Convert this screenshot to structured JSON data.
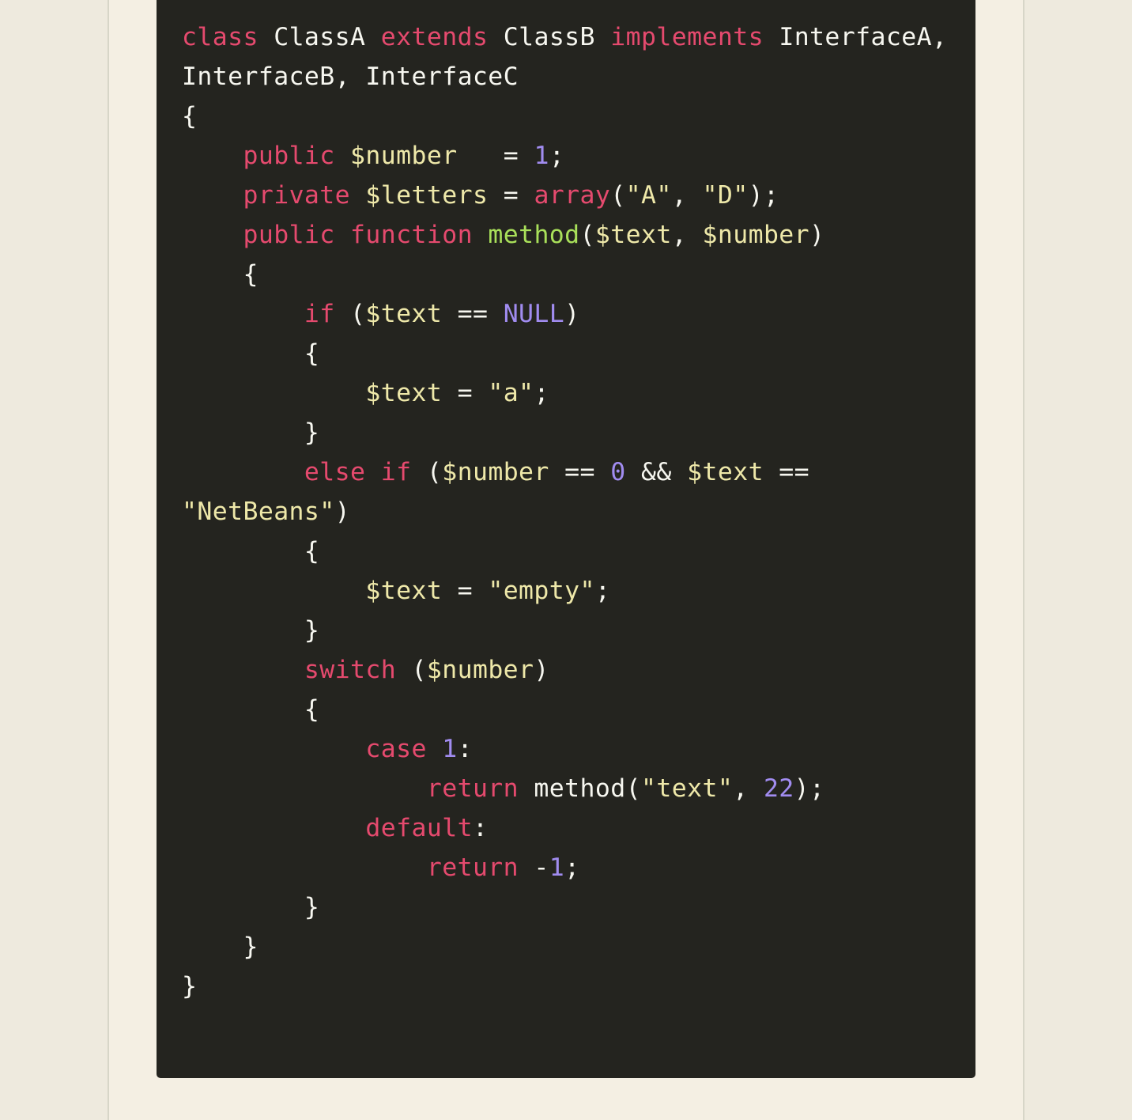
{
  "page": {
    "background_color": "#f4efe3",
    "margin_band_color": "#eeeade",
    "rule_color": "#d7d6c8"
  },
  "code_block": {
    "background_color": "#24241f",
    "language": "php",
    "theme": "dark",
    "font_size_px": 31.5,
    "line_height_px": 50,
    "wrapped": true,
    "palette": {
      "keyword": "#e54a6e",
      "variable": "#eee8a9",
      "string": "#eee8a9",
      "function_name": "#a9e05a",
      "number": "#a18cf0",
      "punctuation": "#f7f7f0",
      "plain": "#f7f7f0"
    },
    "lines": [
      {
        "id": "l1",
        "indent": 0,
        "tokens": [
          {
            "t": "class",
            "c": "kw"
          },
          {
            "t": " ",
            "c": "pl"
          },
          {
            "t": "ClassA",
            "c": "pl"
          },
          {
            "t": " ",
            "c": "pl"
          },
          {
            "t": "extends",
            "c": "kw"
          },
          {
            "t": " ",
            "c": "pl"
          },
          {
            "t": "ClassB",
            "c": "pl"
          },
          {
            "t": " ",
            "c": "pl"
          },
          {
            "t": "implements",
            "c": "kw"
          },
          {
            "t": " ",
            "c": "pl"
          },
          {
            "t": "InterfaceA, InterfaceB, InterfaceC",
            "c": "pl"
          }
        ]
      },
      {
        "id": "l2",
        "indent": 0,
        "tokens": [
          {
            "t": "{",
            "c": "pun"
          }
        ]
      },
      {
        "id": "l3",
        "indent": 4,
        "tokens": [
          {
            "t": "public",
            "c": "kw"
          },
          {
            "t": " ",
            "c": "pl"
          },
          {
            "t": "$number",
            "c": "var"
          },
          {
            "t": "   = ",
            "c": "pun"
          },
          {
            "t": "1",
            "c": "num"
          },
          {
            "t": ";",
            "c": "pun"
          }
        ]
      },
      {
        "id": "l4",
        "indent": 4,
        "tokens": [
          {
            "t": "private",
            "c": "kw"
          },
          {
            "t": " ",
            "c": "pl"
          },
          {
            "t": "$letters",
            "c": "var"
          },
          {
            "t": " = ",
            "c": "pun"
          },
          {
            "t": "array",
            "c": "kw"
          },
          {
            "t": "(",
            "c": "pun"
          },
          {
            "t": "\"A\"",
            "c": "str"
          },
          {
            "t": ", ",
            "c": "pun"
          },
          {
            "t": "\"D\"",
            "c": "str"
          },
          {
            "t": ");",
            "c": "pun"
          }
        ]
      },
      {
        "id": "l5",
        "indent": 4,
        "tokens": [
          {
            "t": "public",
            "c": "kw"
          },
          {
            "t": " ",
            "c": "pl"
          },
          {
            "t": "function",
            "c": "kw"
          },
          {
            "t": " ",
            "c": "pl"
          },
          {
            "t": "method",
            "c": "fn"
          },
          {
            "t": "(",
            "c": "pun"
          },
          {
            "t": "$text",
            "c": "var"
          },
          {
            "t": ", ",
            "c": "pun"
          },
          {
            "t": "$number",
            "c": "var"
          },
          {
            "t": ")",
            "c": "pun"
          }
        ]
      },
      {
        "id": "l6",
        "indent": 4,
        "tokens": [
          {
            "t": "{",
            "c": "pun"
          }
        ]
      },
      {
        "id": "l7",
        "indent": 8,
        "tokens": [
          {
            "t": "if",
            "c": "kw"
          },
          {
            "t": " (",
            "c": "pun"
          },
          {
            "t": "$text",
            "c": "var"
          },
          {
            "t": " == ",
            "c": "pun"
          },
          {
            "t": "NULL",
            "c": "num"
          },
          {
            "t": ")",
            "c": "pun"
          }
        ]
      },
      {
        "id": "l8",
        "indent": 8,
        "tokens": [
          {
            "t": "{",
            "c": "pun"
          }
        ]
      },
      {
        "id": "l9",
        "indent": 12,
        "tokens": [
          {
            "t": "$text",
            "c": "var"
          },
          {
            "t": " = ",
            "c": "pun"
          },
          {
            "t": "\"a\"",
            "c": "str"
          },
          {
            "t": ";",
            "c": "pun"
          }
        ]
      },
      {
        "id": "l10",
        "indent": 8,
        "tokens": [
          {
            "t": "}",
            "c": "pun"
          }
        ]
      },
      {
        "id": "l11",
        "indent": 8,
        "tokens": [
          {
            "t": "else",
            "c": "kw"
          },
          {
            "t": " ",
            "c": "pl"
          },
          {
            "t": "if",
            "c": "kw"
          },
          {
            "t": " (",
            "c": "pun"
          },
          {
            "t": "$number",
            "c": "var"
          },
          {
            "t": " == ",
            "c": "pun"
          },
          {
            "t": "0",
            "c": "num"
          },
          {
            "t": " && ",
            "c": "pun"
          },
          {
            "t": "$text",
            "c": "var"
          },
          {
            "t": " == ",
            "c": "pun"
          },
          {
            "t": "\"NetBeans\"",
            "c": "str"
          },
          {
            "t": ")",
            "c": "pun"
          }
        ]
      },
      {
        "id": "l12",
        "indent": 8,
        "tokens": [
          {
            "t": "{",
            "c": "pun"
          }
        ]
      },
      {
        "id": "l13",
        "indent": 12,
        "tokens": [
          {
            "t": "$text",
            "c": "var"
          },
          {
            "t": " = ",
            "c": "pun"
          },
          {
            "t": "\"empty\"",
            "c": "str"
          },
          {
            "t": ";",
            "c": "pun"
          }
        ]
      },
      {
        "id": "l14",
        "indent": 8,
        "tokens": [
          {
            "t": "}",
            "c": "pun"
          }
        ]
      },
      {
        "id": "l15",
        "indent": 8,
        "tokens": [
          {
            "t": "switch",
            "c": "kw"
          },
          {
            "t": " (",
            "c": "pun"
          },
          {
            "t": "$number",
            "c": "var"
          },
          {
            "t": ")",
            "c": "pun"
          }
        ]
      },
      {
        "id": "l16",
        "indent": 8,
        "tokens": [
          {
            "t": "{",
            "c": "pun"
          }
        ]
      },
      {
        "id": "l17",
        "indent": 12,
        "tokens": [
          {
            "t": "case",
            "c": "kw"
          },
          {
            "t": " ",
            "c": "pl"
          },
          {
            "t": "1",
            "c": "num"
          },
          {
            "t": ":",
            "c": "pun"
          }
        ]
      },
      {
        "id": "l18",
        "indent": 16,
        "tokens": [
          {
            "t": "return",
            "c": "kw"
          },
          {
            "t": " ",
            "c": "pl"
          },
          {
            "t": "method",
            "c": "pl"
          },
          {
            "t": "(",
            "c": "pun"
          },
          {
            "t": "\"text\"",
            "c": "str"
          },
          {
            "t": ", ",
            "c": "pun"
          },
          {
            "t": "22",
            "c": "num"
          },
          {
            "t": ");",
            "c": "pun"
          }
        ]
      },
      {
        "id": "l19",
        "indent": 12,
        "tokens": [
          {
            "t": "default",
            "c": "kw"
          },
          {
            "t": ":",
            "c": "pun"
          }
        ]
      },
      {
        "id": "l20",
        "indent": 16,
        "tokens": [
          {
            "t": "return",
            "c": "kw"
          },
          {
            "t": " ",
            "c": "pl"
          },
          {
            "t": "-",
            "c": "pun"
          },
          {
            "t": "1",
            "c": "num"
          },
          {
            "t": ";",
            "c": "pun"
          }
        ]
      },
      {
        "id": "l21",
        "indent": 8,
        "tokens": [
          {
            "t": "}",
            "c": "pun"
          }
        ]
      },
      {
        "id": "l22",
        "indent": 4,
        "tokens": [
          {
            "t": "}",
            "c": "pun"
          }
        ]
      },
      {
        "id": "l23",
        "indent": 0,
        "tokens": [
          {
            "t": "}",
            "c": "pun"
          }
        ]
      }
    ]
  }
}
